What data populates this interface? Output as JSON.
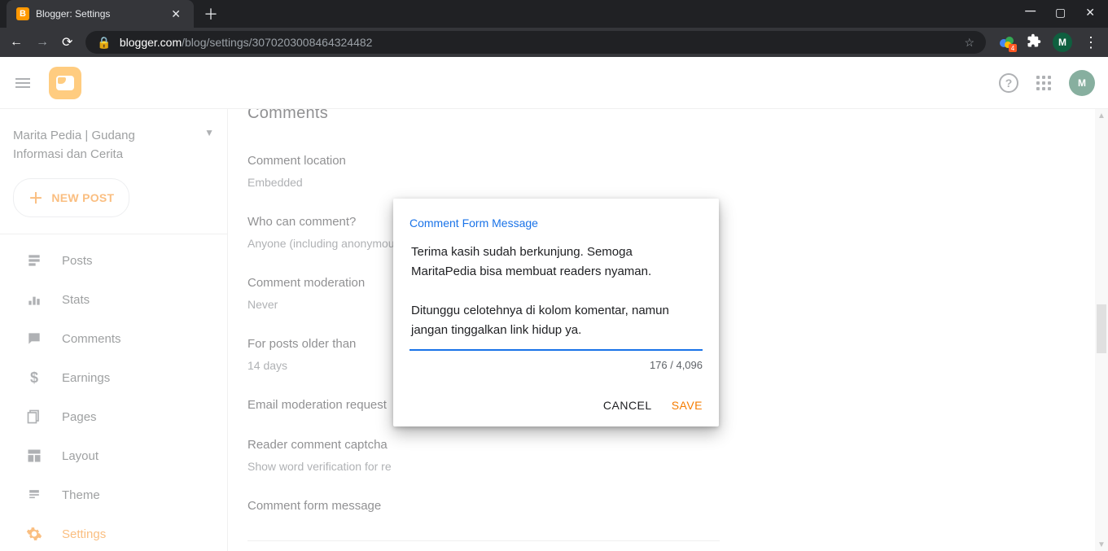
{
  "browser": {
    "tab_title": "Blogger: Settings",
    "url_domain": "blogger.com",
    "url_path": "/blog/settings/3070203008464324482",
    "profile_letter": "M",
    "balloon_badge": "4"
  },
  "appbar": {
    "profile_letter": "M"
  },
  "sidebar": {
    "blog_name_line1": "Marita Pedia | Gudang",
    "blog_name_line2": "Informasi dan Cerita",
    "new_post": "NEW POST",
    "items": [
      {
        "label": "Posts"
      },
      {
        "label": "Stats"
      },
      {
        "label": "Comments"
      },
      {
        "label": "Earnings"
      },
      {
        "label": "Pages"
      },
      {
        "label": "Layout"
      },
      {
        "label": "Theme"
      },
      {
        "label": "Settings"
      }
    ]
  },
  "main": {
    "section_heading": "Comments",
    "settings": [
      {
        "label": "Comment location",
        "value": "Embedded"
      },
      {
        "label": "Who can comment?",
        "value": "Anyone (including anonymou"
      },
      {
        "label": "Comment moderation",
        "value": "Never"
      },
      {
        "label": "For posts older than",
        "value": "14 days"
      },
      {
        "label": "Email moderation request"
      },
      {
        "label": "Reader comment captcha",
        "value": "Show word verification for re"
      },
      {
        "label": "Comment form message"
      }
    ]
  },
  "dialog": {
    "title": "Comment Form Message",
    "text": "Terima kasih sudah berkunjung. Semoga MaritaPedia bisa membuat readers nyaman. \n\nDitunggu celotehnya di kolom komentar, namun jangan tinggalkan link hidup ya.",
    "char_count": "176 / 4,096",
    "cancel": "CANCEL",
    "save": "SAVE"
  }
}
